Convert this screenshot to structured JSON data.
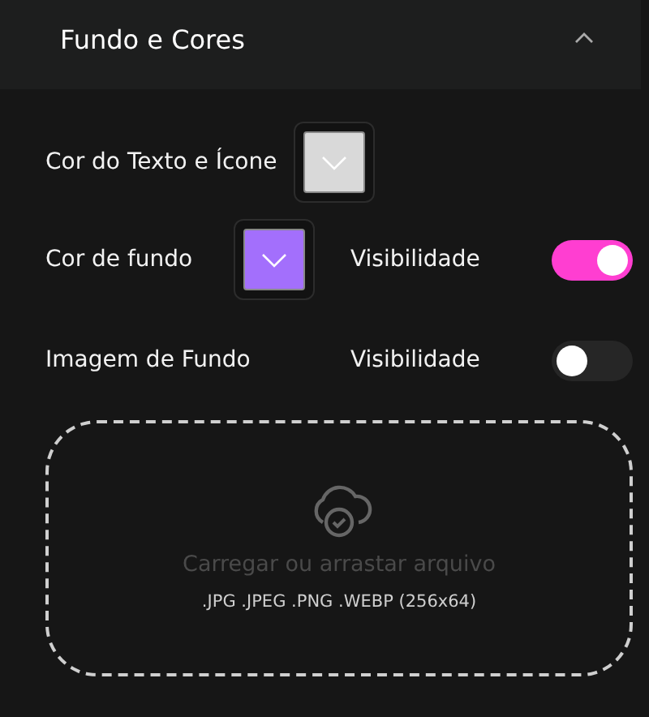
{
  "section": {
    "title": "Fundo e Cores",
    "expanded": true
  },
  "rows": [
    {
      "label": "Cor do Texto e Ícone",
      "color": "#d9d9d9"
    },
    {
      "label": "Cor de fundo",
      "color": "#a36ffc",
      "visibility": {
        "label": "Visibilidade",
        "on": true
      }
    },
    {
      "label": "Imagem de Fundo",
      "visibility": {
        "label": "Visibilidade",
        "on": false
      }
    }
  ],
  "upload": {
    "title": "Carregar ou arrastar arquivo",
    "formats": ".JPG .JPEG .PNG .WEBP (256x64)"
  }
}
